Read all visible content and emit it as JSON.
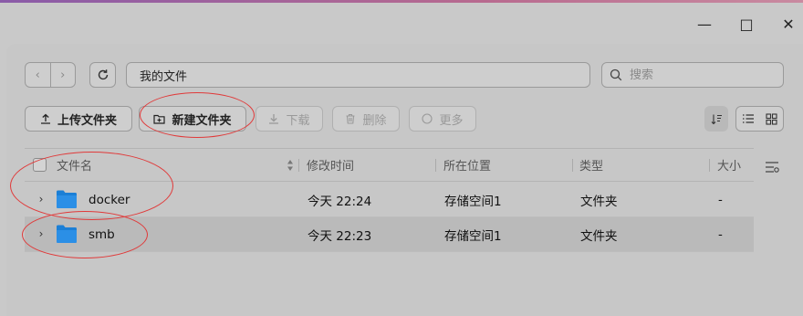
{
  "window": {
    "minimize_glyph": "—",
    "maximize_glyph": "□",
    "close_glyph": "✕"
  },
  "nav": {
    "back_glyph": "‹",
    "forward_glyph": "›"
  },
  "path": "我的文件",
  "search": {
    "placeholder": "搜索"
  },
  "toolbar": {
    "upload_label": "上传文件夹",
    "new_folder_label": "新建文件夹",
    "download_label": "下载",
    "delete_label": "删除",
    "more_label": "更多"
  },
  "table": {
    "columns": {
      "name": "文件名",
      "modified": "修改时间",
      "location": "所在位置",
      "type": "类型",
      "size": "大小"
    },
    "rows": [
      {
        "name": "docker",
        "modified": "今天 22:24",
        "location": "存储空间1",
        "type": "文件夹",
        "size": "-"
      },
      {
        "name": "smb",
        "modified": "今天 22:23",
        "location": "存储空间1",
        "type": "文件夹",
        "size": "-"
      }
    ]
  },
  "colors": {
    "folder": "#1b7fd6",
    "annotation": "#e03a3a"
  }
}
